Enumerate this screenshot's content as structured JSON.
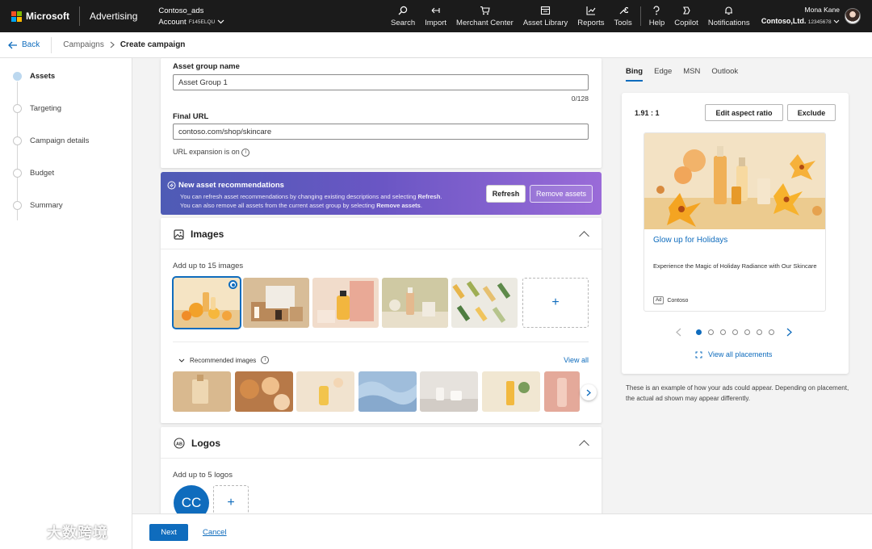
{
  "topbar": {
    "brand": "Microsoft",
    "product": "Advertising",
    "account_name": "Contoso_ads",
    "account_label": "Account",
    "account_id": "F145ELQU",
    "nav": [
      {
        "label": "Search",
        "icon": "search-icon"
      },
      {
        "label": "Import",
        "icon": "import-icon"
      },
      {
        "label": "Merchant Center",
        "icon": "cart-icon"
      },
      {
        "label": "Asset Library",
        "icon": "asset-library-icon"
      },
      {
        "label": "Reports",
        "icon": "reports-icon"
      },
      {
        "label": "Tools",
        "icon": "tools-icon"
      },
      {
        "label": "Help",
        "icon": "help-icon"
      },
      {
        "label": "Copilot",
        "icon": "copilot-icon"
      },
      {
        "label": "Notifications",
        "icon": "bell-icon"
      }
    ],
    "user_name": "Mona Kane",
    "org_name": "Contoso,Ltd.",
    "org_id": "12345678"
  },
  "breadcrumb": {
    "back": "Back",
    "items": [
      "Campaigns",
      "Create campaign"
    ]
  },
  "steps": [
    "Assets",
    "Targeting",
    "Campaign details",
    "Budget",
    "Summary"
  ],
  "asset_group": {
    "name_label": "Asset group name",
    "name_value": "Asset Group 1",
    "name_counter": "0/128",
    "url_label": "Final URL",
    "url_value": "contoso.com/shop/skincare",
    "url_expansion": "URL expansion is on"
  },
  "recommendation_banner": {
    "title": "New asset recommendations",
    "line1_prefix": "You can refresh asset recommendations by changing existing descriptions and selecting ",
    "line1_bold": "Refresh",
    "line1_suffix": ".",
    "line2_prefix": "You can also remove all assets from the current asset group by selecting ",
    "line2_bold": "Remove assets",
    "line2_suffix": ".",
    "refresh_label": "Refresh",
    "remove_label": "Remove assets"
  },
  "images_section": {
    "title": "Images",
    "hint": "Add up to 15 images",
    "add_label": "+",
    "recommended_label": "Recommended images",
    "view_all": "View all"
  },
  "logos_section": {
    "title": "Logos",
    "hint": "Add up to 5 logos",
    "logo_text": "CC",
    "add_label": "+"
  },
  "footer": {
    "next_label": "Next",
    "cancel_label": "Cancel"
  },
  "preview": {
    "tabs": [
      "Bing",
      "Edge",
      "MSN",
      "Outlook"
    ],
    "aspect_ratio": "1.91 : 1",
    "edit_ratio_label": "Edit aspect ratio",
    "exclude_label": "Exclude",
    "ad_headline": "Glow up for Holidays",
    "ad_description": "Experience the Magic of Holiday Radiance with Our Skincare",
    "ad_badge": "Ad",
    "ad_advertiser": "Contoso",
    "pager_count": 7,
    "pager_active": 1,
    "view_all_placements": "View all placements",
    "disclaimer": "These is an example of how your ads could appear. Depending on placement, the actual ad shown may appear differently."
  },
  "colors": {
    "accent": "#0f6cbd",
    "topbar_bg": "#1b1b1b",
    "banner_start": "#4e5bb5",
    "banner_end": "#9a6bd8"
  },
  "watermark": "大数跨境"
}
